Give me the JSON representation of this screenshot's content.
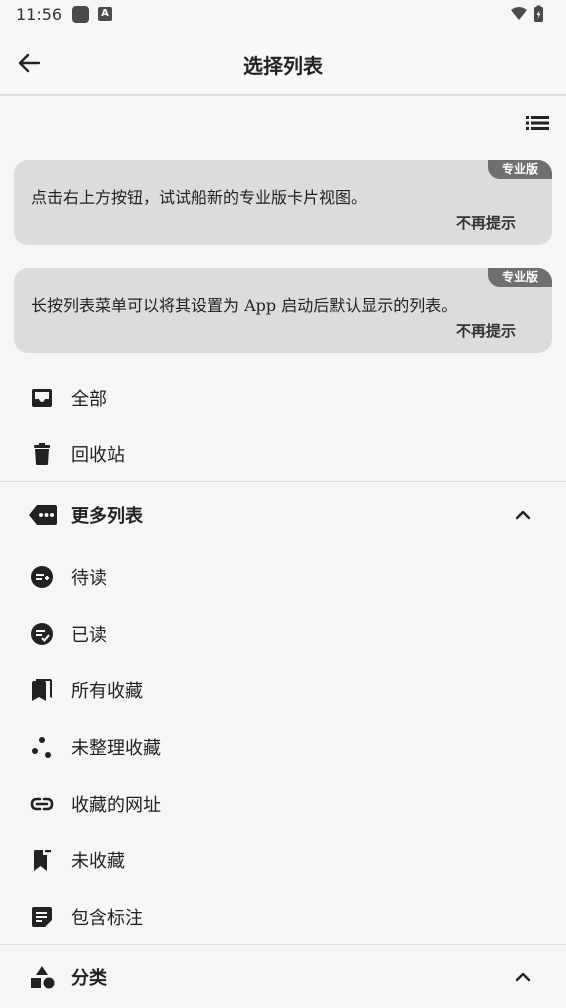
{
  "status_bar": {
    "time": "11:56",
    "notification_icon": "A"
  },
  "app_bar": {
    "title": "选择列表",
    "back_icon": "arrow-left-icon"
  },
  "toolbar": {
    "view_toggle_icon": "list-view-icon"
  },
  "promo_cards": [
    {
      "badge": "专业版",
      "text": "点击右上方按钮，试试船新的专业版卡片视图。",
      "dismiss": "不再提示"
    },
    {
      "badge": "专业版",
      "text": "长按列表菜单可以将其设置为 App 启动后默认显示的列表。",
      "dismiss": "不再提示"
    }
  ],
  "main_lists": [
    {
      "label": "全部",
      "icon": "inbox-icon"
    },
    {
      "label": "回收站",
      "icon": "trash-icon"
    }
  ],
  "more_lists": {
    "header": "更多列表",
    "icon": "more-tag-icon",
    "expanded": true,
    "items": [
      {
        "label": "待读",
        "icon": "add-circle-icon"
      },
      {
        "label": "已读",
        "icon": "check-circle-icon"
      },
      {
        "label": "所有收藏",
        "icon": "bookmarks-icon"
      },
      {
        "label": "未整理收藏",
        "icon": "scatter-dots-icon"
      },
      {
        "label": "收藏的网址",
        "icon": "link-icon"
      },
      {
        "label": "未收藏",
        "icon": "bookmark-remove-icon"
      },
      {
        "label": "包含标注",
        "icon": "note-icon"
      }
    ]
  },
  "categories": {
    "header": "分类",
    "icon": "shapes-icon",
    "expanded": true
  },
  "colors": {
    "background": "#f6f6f6",
    "card": "#dcdcdc",
    "badge": "#6f6f6f",
    "text": "#222222"
  }
}
